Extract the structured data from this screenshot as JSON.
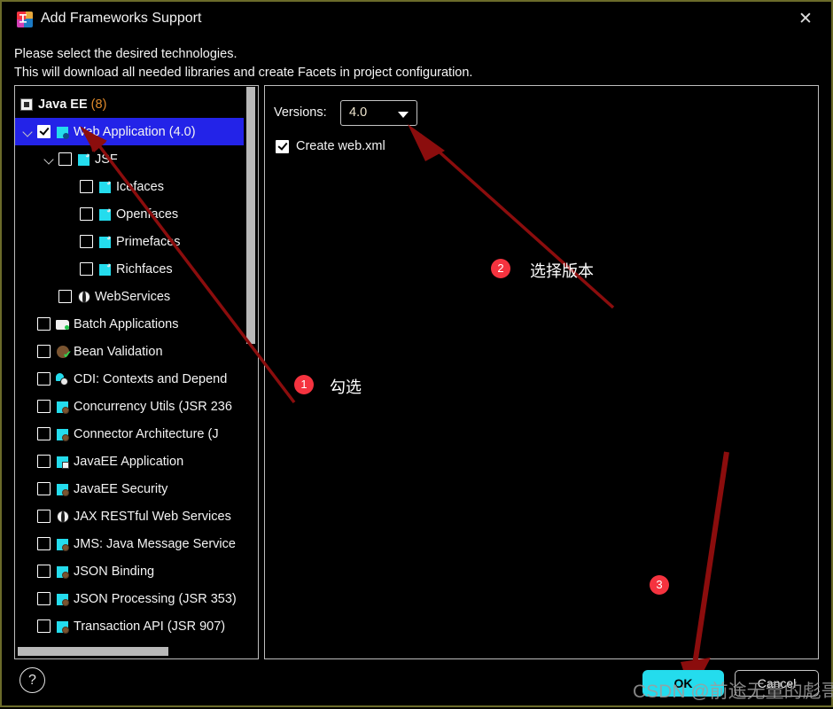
{
  "window": {
    "title": "Add Frameworks Support",
    "app_icon": "intellij-idea-icon",
    "close_icon": "close-icon",
    "border_color": "#6b6b2a"
  },
  "header": {
    "line1": "Please select the desired technologies.",
    "line2": "This will download all needed libraries and create Facets in project configuration."
  },
  "tree": {
    "group_label": "Java EE",
    "group_count": "(8)",
    "nodes": [
      {
        "label": "Web Application (4.0)",
        "icon": "web-application-icon",
        "checked": true,
        "selected": true,
        "expanded": true,
        "indent": 0
      },
      {
        "label": "JSF",
        "icon": "jsf-icon",
        "checked": false,
        "selected": false,
        "expanded": true,
        "indent": 1
      },
      {
        "label": "Icefaces",
        "icon": "icefaces-icon",
        "checked": false,
        "selected": false,
        "indent": 2
      },
      {
        "label": "Openfaces",
        "icon": "openfaces-icon",
        "checked": false,
        "selected": false,
        "indent": 2
      },
      {
        "label": "Primefaces",
        "icon": "primefaces-icon",
        "checked": false,
        "selected": false,
        "indent": 2
      },
      {
        "label": "Richfaces",
        "icon": "richfaces-icon",
        "checked": false,
        "selected": false,
        "indent": 2
      },
      {
        "label": "WebServices",
        "icon": "webservices-globe-icon",
        "checked": false,
        "selected": false,
        "indent": 1
      },
      {
        "label": "Batch Applications",
        "icon": "batch-folder-icon",
        "checked": false,
        "selected": false,
        "indent": 0
      },
      {
        "label": "Bean Validation",
        "icon": "bean-validation-icon",
        "checked": false,
        "selected": false,
        "indent": 0
      },
      {
        "label": "CDI: Contexts and Depend",
        "icon": "cdi-icon",
        "checked": false,
        "selected": false,
        "indent": 0
      },
      {
        "label": "Concurrency Utils (JSR 236",
        "icon": "java-bean-icon",
        "checked": false,
        "selected": false,
        "indent": 0
      },
      {
        "label": "Connector Architecture (J",
        "icon": "java-bean-icon",
        "checked": false,
        "selected": false,
        "indent": 0
      },
      {
        "label": "JavaEE Application",
        "icon": "javaee-application-icon",
        "checked": false,
        "selected": false,
        "indent": 0
      },
      {
        "label": "JavaEE Security",
        "icon": "java-bean-icon",
        "checked": false,
        "selected": false,
        "indent": 0
      },
      {
        "label": "JAX RESTful Web Services",
        "icon": "webservices-globe-icon",
        "checked": false,
        "selected": false,
        "indent": 0
      },
      {
        "label": "JMS: Java Message Service",
        "icon": "java-bean-icon",
        "checked": false,
        "selected": false,
        "indent": 0
      },
      {
        "label": "JSON Binding",
        "icon": "java-bean-icon",
        "checked": false,
        "selected": false,
        "indent": 0
      },
      {
        "label": "JSON Processing (JSR 353)",
        "icon": "java-bean-icon",
        "checked": false,
        "selected": false,
        "indent": 0
      },
      {
        "label": "Transaction API (JSR 907)",
        "icon": "java-bean-icon",
        "checked": false,
        "selected": false,
        "indent": 0
      }
    ]
  },
  "details": {
    "versions_label": "Versions:",
    "version_value": "4.0",
    "create_webxml_label": "Create web.xml",
    "create_webxml_checked": true
  },
  "annotations": {
    "badge1": "1",
    "text1": "勾选",
    "badge2": "2",
    "text2": "选择版本",
    "badge3": "3",
    "badge_color": "#f5333f",
    "arrow_color": "#8b0d0d"
  },
  "footer": {
    "help_label": "?",
    "ok_label": "OK",
    "cancel_label": "Cancel",
    "watermark": "CSDN @前途无量的彪哥"
  }
}
